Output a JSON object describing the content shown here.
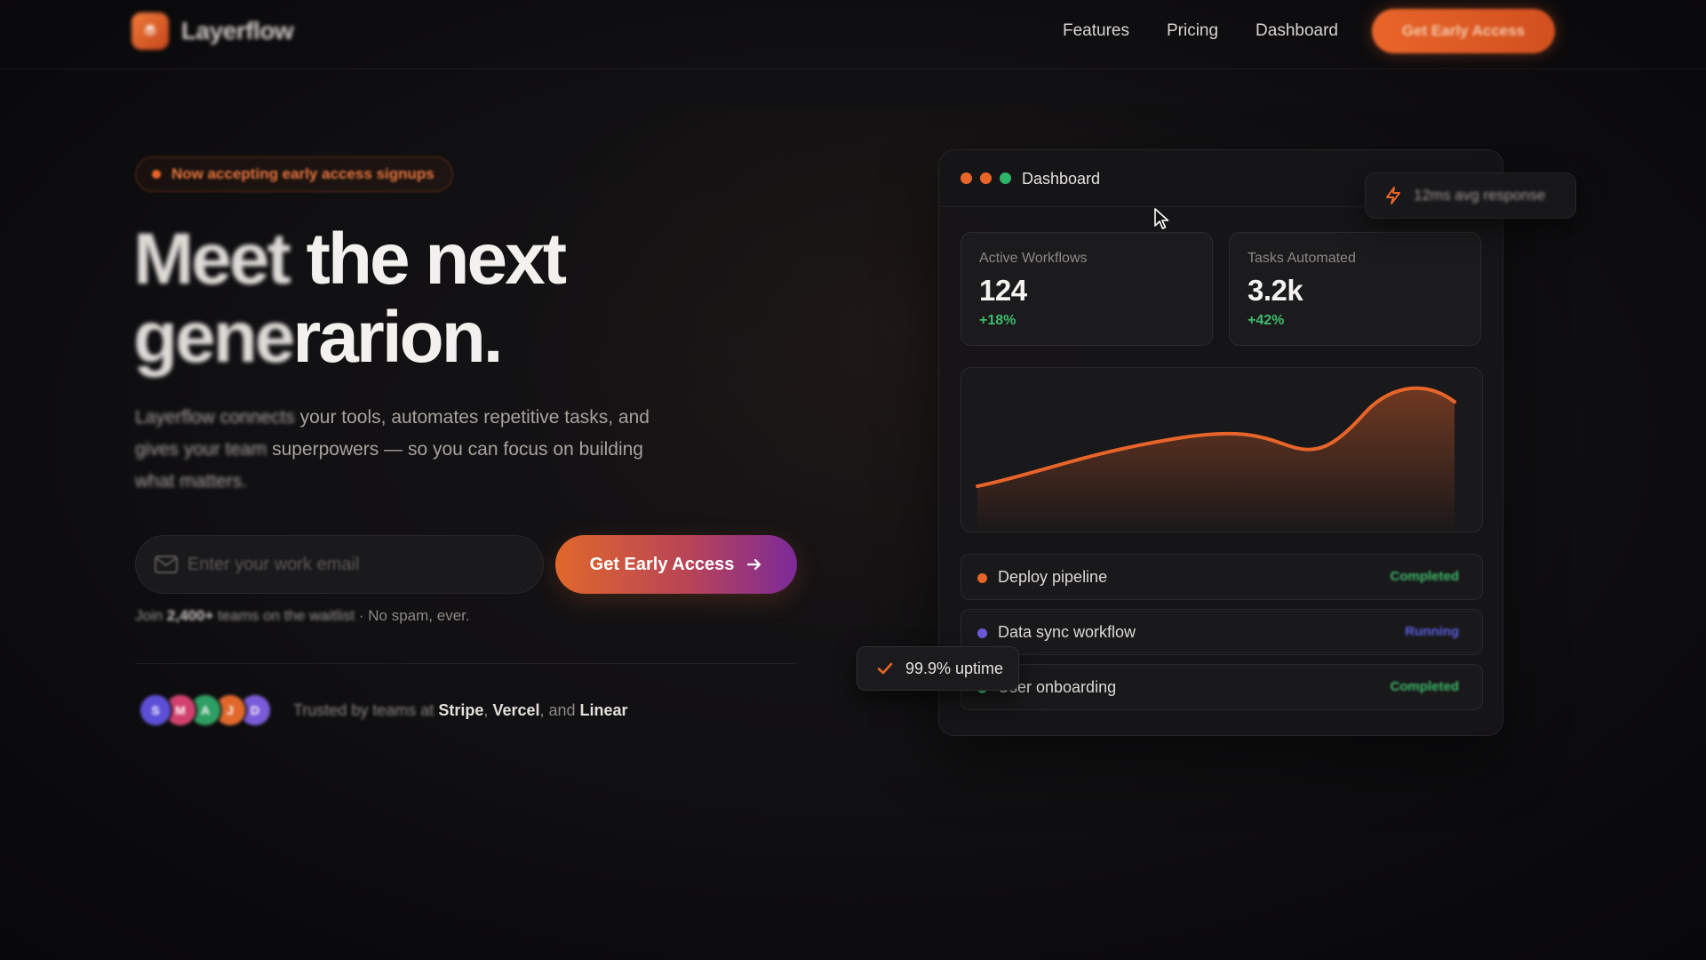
{
  "nav": {
    "brand": "Layerflow",
    "links": [
      "Features",
      "Pricing",
      "Dashboard"
    ],
    "cta": "Get Early Access"
  },
  "hero": {
    "badge": "Now accepting early access signups",
    "headline_line1_a": "Meet",
    "headline_line1_b": " the next",
    "headline_line2_a": "gene",
    "headline_line2_b": "rarion.",
    "sub_blur_1": "Layerflow connects",
    "sub_text_1": " your tools, automates repetitive tasks, and",
    "sub_blur_2": "gives your team",
    "sub_text_2": " superpowers — so you can focus on building",
    "sub_blur_3": "what matters.",
    "email_placeholder": "Enter your work email",
    "cta": "Get Early Access",
    "waitlist_prefix": "Join ",
    "waitlist_count": "2,400+",
    "waitlist_mid": " teams on the waitlist",
    "waitlist_suffix": " · No spam, ever.",
    "trusted_prefix": "Trusted by teams at ",
    "trusted_company_1": "Stripe",
    "trusted_sep_1": ", ",
    "trusted_company_2": "Vercel",
    "trusted_sep_2": ", and ",
    "trusted_company_3": "Linear",
    "avatars": [
      {
        "initial": "S",
        "color": "#5b4fd6"
      },
      {
        "initial": "M",
        "color": "#d2416e"
      },
      {
        "initial": "A",
        "color": "#2f9e62"
      },
      {
        "initial": "J",
        "color": "#e0682b"
      },
      {
        "initial": "D",
        "color": "#7a5bd8"
      }
    ]
  },
  "dashboard": {
    "title": "Dashboard",
    "window_dots": [
      "#e8652a",
      "#e8652a",
      "#2fb36a"
    ],
    "stats": [
      {
        "label": "Active Workflows",
        "value": "124",
        "delta": "+18%"
      },
      {
        "label": "Tasks Automated",
        "value": "3.2k",
        "delta": "+42%"
      }
    ],
    "tasks": [
      {
        "name": "Deploy pipeline",
        "status": "Completed",
        "dot": "#e8652a",
        "status_color": "#3fba6c"
      },
      {
        "name": "Data sync workflow",
        "status": "Running",
        "dot": "#6b5bd6",
        "status_color": "#5b5ee0"
      },
      {
        "name": "User onboarding",
        "status": "Completed",
        "dot": "#3fba6c",
        "status_color": "#3fba6c"
      }
    ],
    "response_badge": "12ms avg response",
    "uptime_badge": "99.9% uptime"
  },
  "colors": {
    "accent": "#e8652a",
    "success": "#3fba6c",
    "running": "#5b5ee0"
  }
}
